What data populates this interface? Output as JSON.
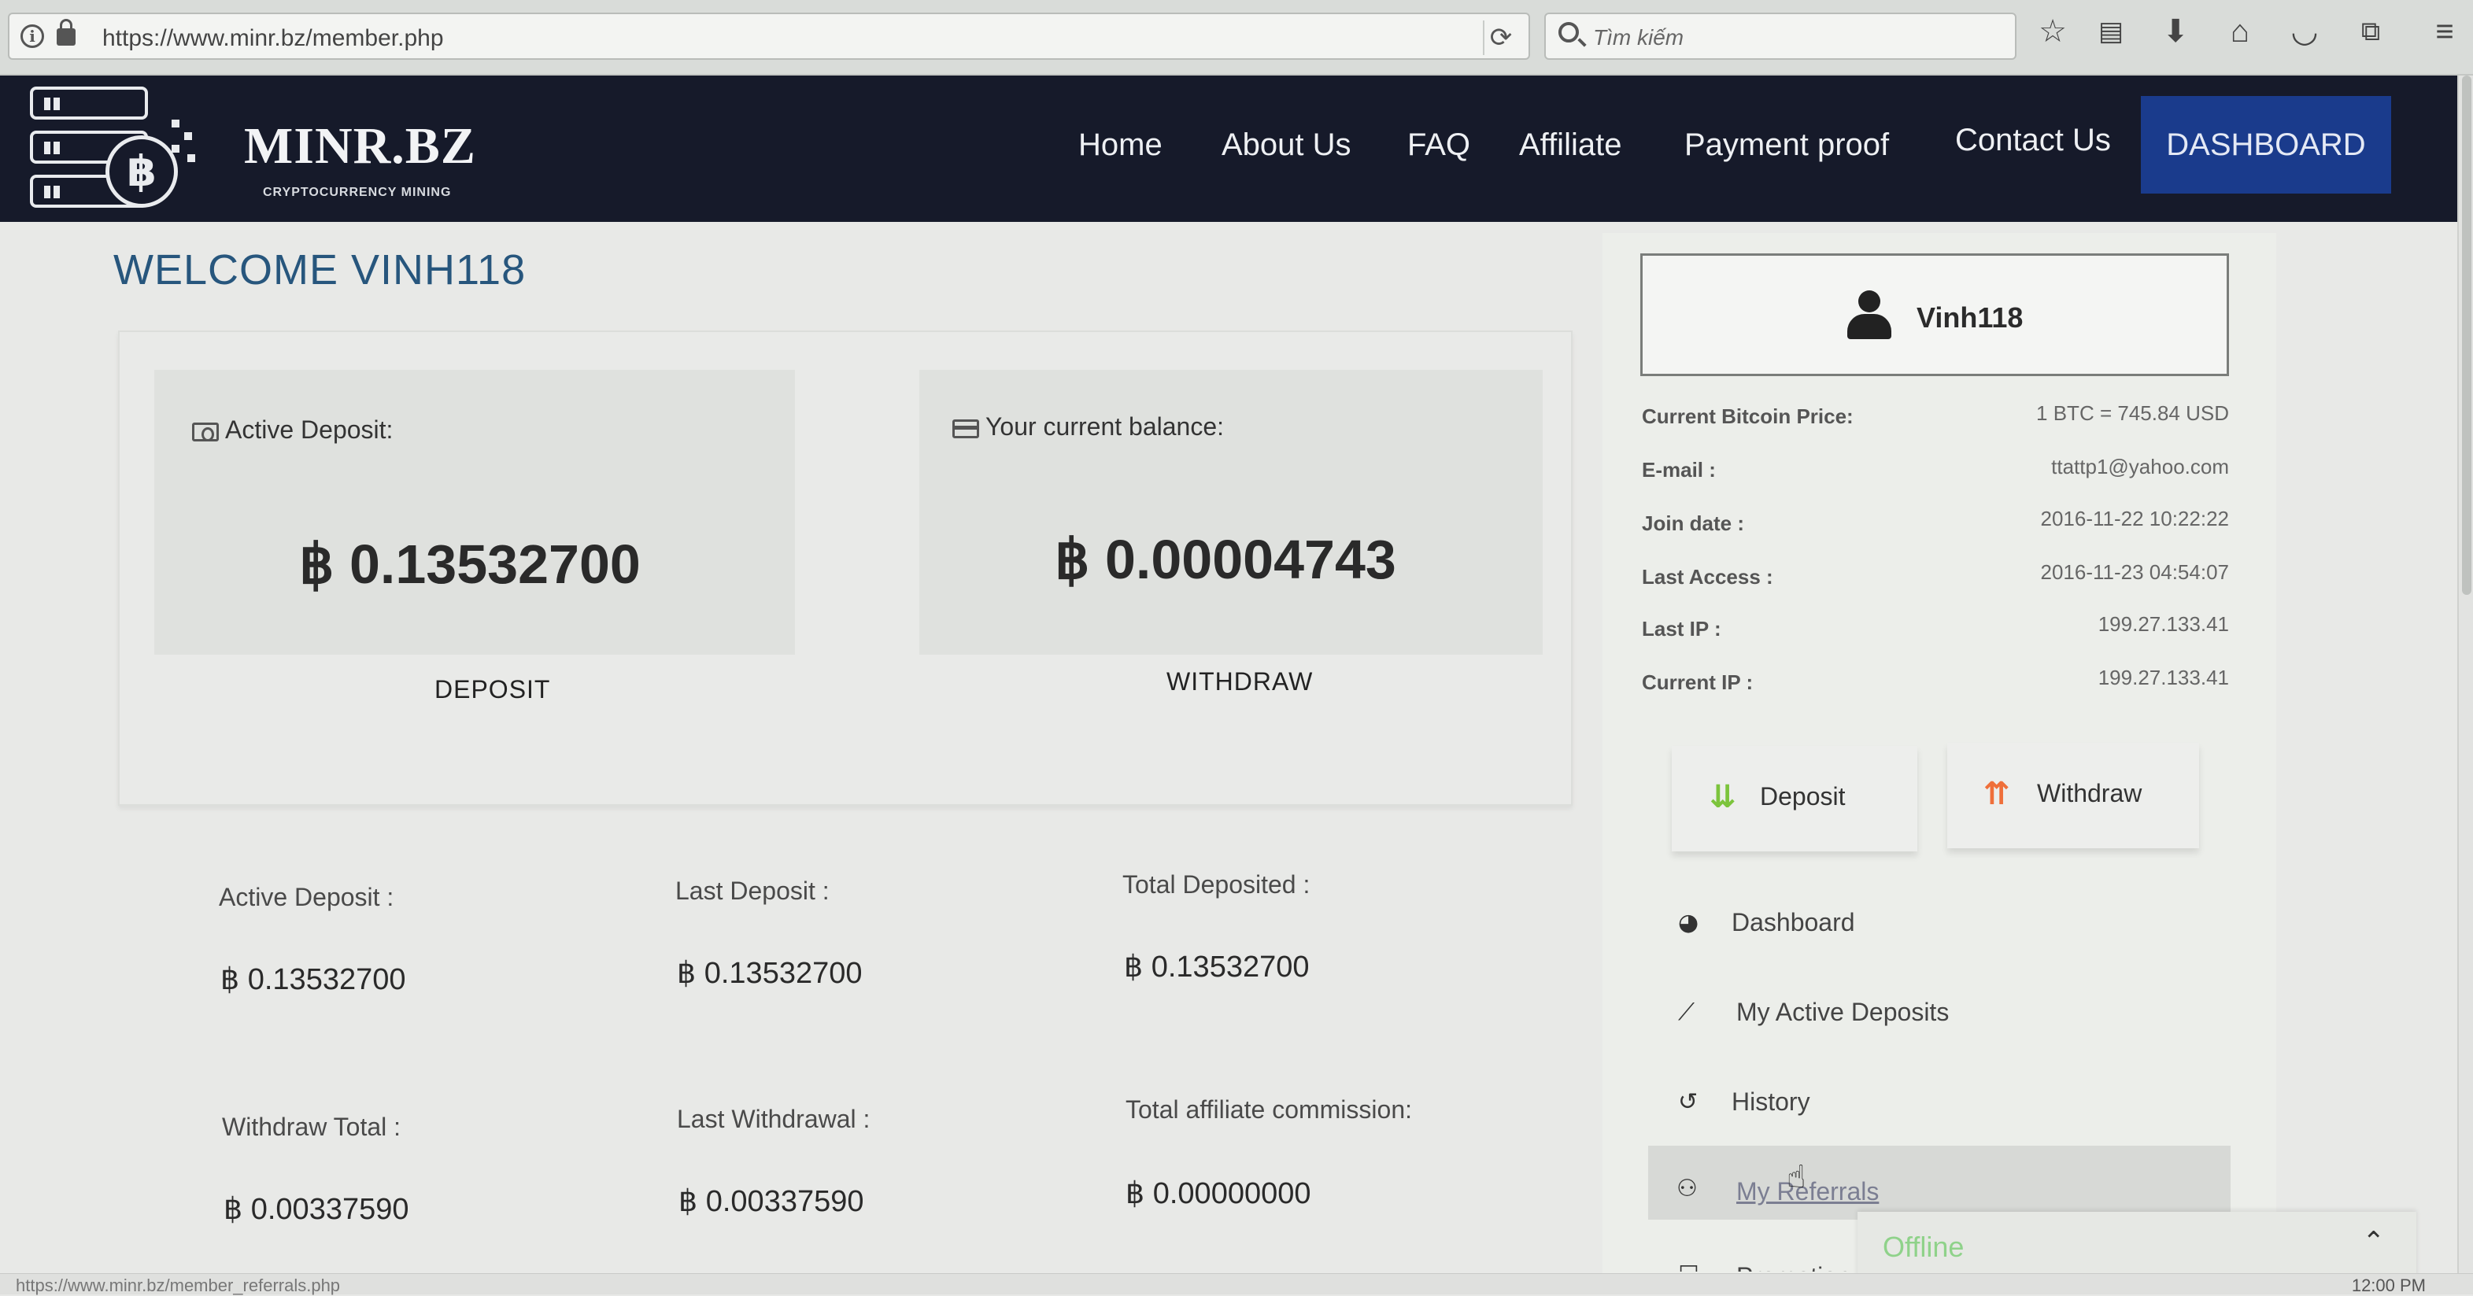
{
  "browser": {
    "url": "https://www.minr.bz/member.php",
    "search_placeholder": "Tìm kiếm",
    "toolbar_icons": [
      "bookmark-star-icon",
      "reading-list-icon",
      "download-icon",
      "home-icon",
      "pocket-icon",
      "extensions-icon",
      "menu-icon"
    ],
    "status_url": "https://www.minr.bz/member_referrals.php",
    "clock": "12:00 PM"
  },
  "site": {
    "brand": "MINR.BZ",
    "tagline": "CRYPTOCURRENCY MINING",
    "nav": [
      "Home",
      "About Us",
      "FAQ",
      "Affiliate",
      "Payment proof",
      "Contact Us"
    ],
    "nav_active": "DASHBOARD",
    "accent_color": "#1a3b8c",
    "header_color": "#161a2a"
  },
  "page": {
    "title": "WELCOME VINH118"
  },
  "cards": {
    "active_deposit": {
      "label": "Active Deposit:",
      "value": "฿ 0.13532700",
      "action": "DEPOSIT"
    },
    "balance": {
      "label": "Your current balance:",
      "value": "฿ 0.00004743",
      "action": "WITHDRAW"
    }
  },
  "stats": [
    {
      "label": "Active Deposit :",
      "value": "฿ 0.13532700"
    },
    {
      "label": "Last Deposit :",
      "value": "฿ 0.13532700"
    },
    {
      "label": "Total Deposited :",
      "value": "฿ 0.13532700"
    },
    {
      "label": "Withdraw Total :",
      "value": "฿ 0.00337590"
    },
    {
      "label": "Last Withdrawal :",
      "value": "฿ 0.00337590"
    },
    {
      "label": "Total affiliate commission:",
      "value": "฿ 0.00000000"
    }
  ],
  "sidebar": {
    "username": "Vinh118",
    "info": [
      {
        "label": "Current Bitcoin Price:",
        "value": "1 BTC = 745.84 USD"
      },
      {
        "label": "E-mail :",
        "value": "ttattp1@yahoo.com"
      },
      {
        "label": "Join date :",
        "value": "2016-11-22 10:22:22"
      },
      {
        "label": "Last Access :",
        "value": "2016-11-23 04:54:07"
      },
      {
        "label": "Last IP :",
        "value": "199.27.133.41"
      },
      {
        "label": "Current IP :",
        "value": "199.27.133.41"
      }
    ],
    "buttons": {
      "deposit": "Deposit",
      "withdraw": "Withdraw"
    },
    "menu": [
      {
        "label": "Dashboard",
        "icon": "dashboard-icon"
      },
      {
        "label": "My Active Deposits",
        "icon": "chart-icon"
      },
      {
        "label": "History",
        "icon": "history-icon"
      },
      {
        "label": "My Referrals",
        "icon": "users-icon"
      },
      {
        "label": "Promotion",
        "icon": "promotion-icon"
      }
    ],
    "menu_hovered": "My Referrals"
  },
  "chat": {
    "status": "Offline",
    "status_color": "#8fd28a"
  }
}
